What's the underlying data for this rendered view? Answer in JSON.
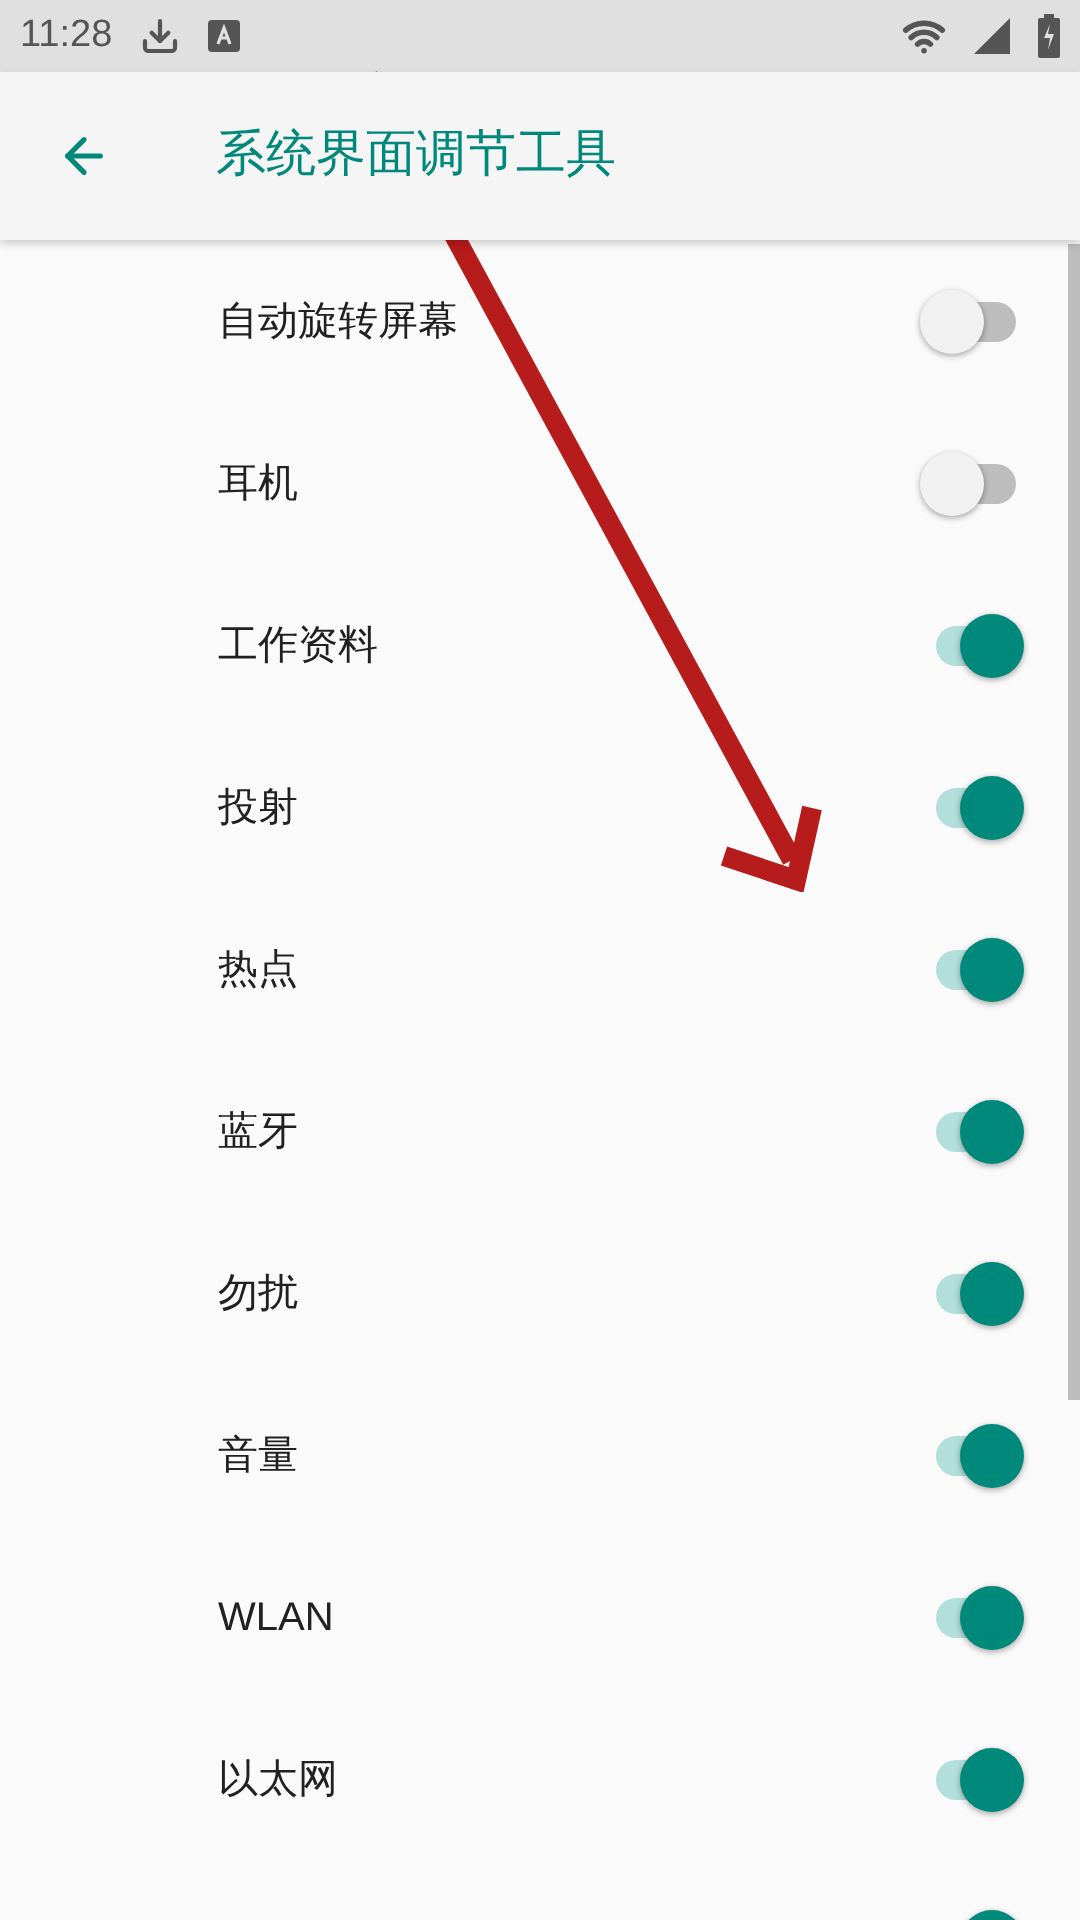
{
  "status_bar": {
    "time": "11:28"
  },
  "app_bar": {
    "title": "系统界面调节工具"
  },
  "items": [
    {
      "label": "自动旋转屏幕",
      "on": false
    },
    {
      "label": "耳机",
      "on": false
    },
    {
      "label": "工作资料",
      "on": true
    },
    {
      "label": "投射",
      "on": true
    },
    {
      "label": "热点",
      "on": true
    },
    {
      "label": "蓝牙",
      "on": true
    },
    {
      "label": "勿扰",
      "on": true
    },
    {
      "label": "音量",
      "on": true
    },
    {
      "label": "WLAN",
      "on": true
    },
    {
      "label": "以太网",
      "on": true
    },
    {
      "on": true
    }
  ]
}
